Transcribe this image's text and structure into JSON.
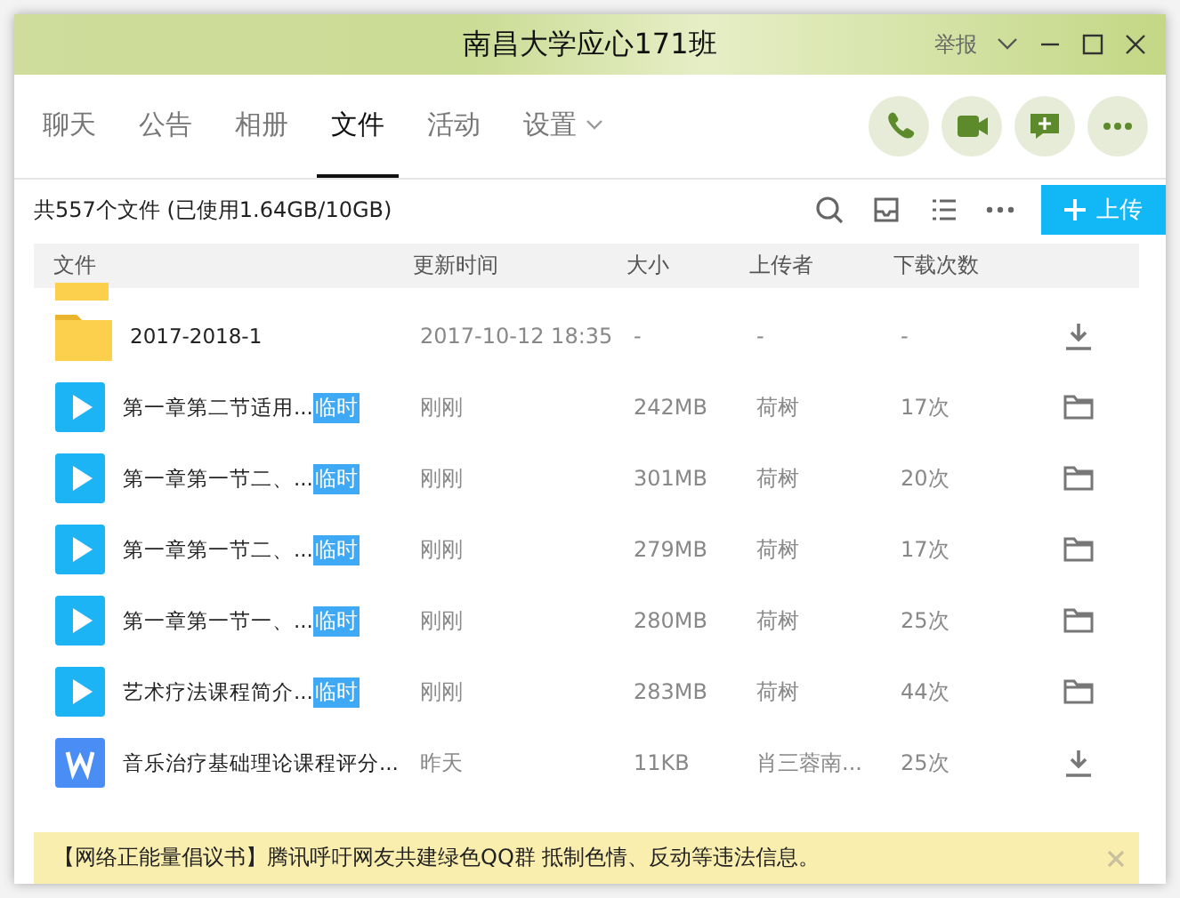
{
  "window": {
    "title": "南昌大学应心171班",
    "report": "举报"
  },
  "tabs": [
    {
      "label": "聊天",
      "selected": false
    },
    {
      "label": "公告",
      "selected": false
    },
    {
      "label": "相册",
      "selected": false
    },
    {
      "label": "文件",
      "selected": true
    },
    {
      "label": "活动",
      "selected": false
    },
    {
      "label": "设置",
      "selected": false,
      "dropdown": true
    }
  ],
  "summary": "共557个文件 (已使用1.64GB/10GB)",
  "upload_button": "上传",
  "table": {
    "columns": [
      "文件",
      "更新时间",
      "大小",
      "上传者",
      "下载次数"
    ],
    "rows": [
      {
        "kind": "folder",
        "name": "2017-2018-1",
        "time": "2017-10-12 18:35",
        "size": "-",
        "uploader": "-",
        "downloads": "-",
        "downloaded": false
      },
      {
        "kind": "video",
        "name": "第一章第二节适用...",
        "badge": "临时",
        "time": "刚刚",
        "size": "242MB",
        "uploader": "荷树",
        "downloads": "17次",
        "downloaded": true
      },
      {
        "kind": "video",
        "name": "第一章第一节二、...",
        "badge": "临时",
        "time": "刚刚",
        "size": "301MB",
        "uploader": "荷树",
        "downloads": "20次",
        "downloaded": true
      },
      {
        "kind": "video",
        "name": "第一章第一节二、...",
        "badge": "临时",
        "time": "刚刚",
        "size": "279MB",
        "uploader": "荷树",
        "downloads": "17次",
        "downloaded": true
      },
      {
        "kind": "video",
        "name": "第一章第一节一、...",
        "badge": "临时",
        "time": "刚刚",
        "size": "280MB",
        "uploader": "荷树",
        "downloads": "25次",
        "downloaded": true
      },
      {
        "kind": "video",
        "name": "艺术疗法课程简介...",
        "badge": "临时",
        "time": "刚刚",
        "size": "283MB",
        "uploader": "荷树",
        "downloads": "44次",
        "downloaded": true
      },
      {
        "kind": "doc",
        "name": "音乐治疗基础理论课程评分...",
        "time": "昨天",
        "size": "11KB",
        "uploader": "肖三蓉南...",
        "downloads": "25次",
        "downloaded": false
      }
    ]
  },
  "notice": "【网络正能量倡议书】腾讯呼吁网友共建绿色QQ群 抵制色情、反动等违法信息。"
}
